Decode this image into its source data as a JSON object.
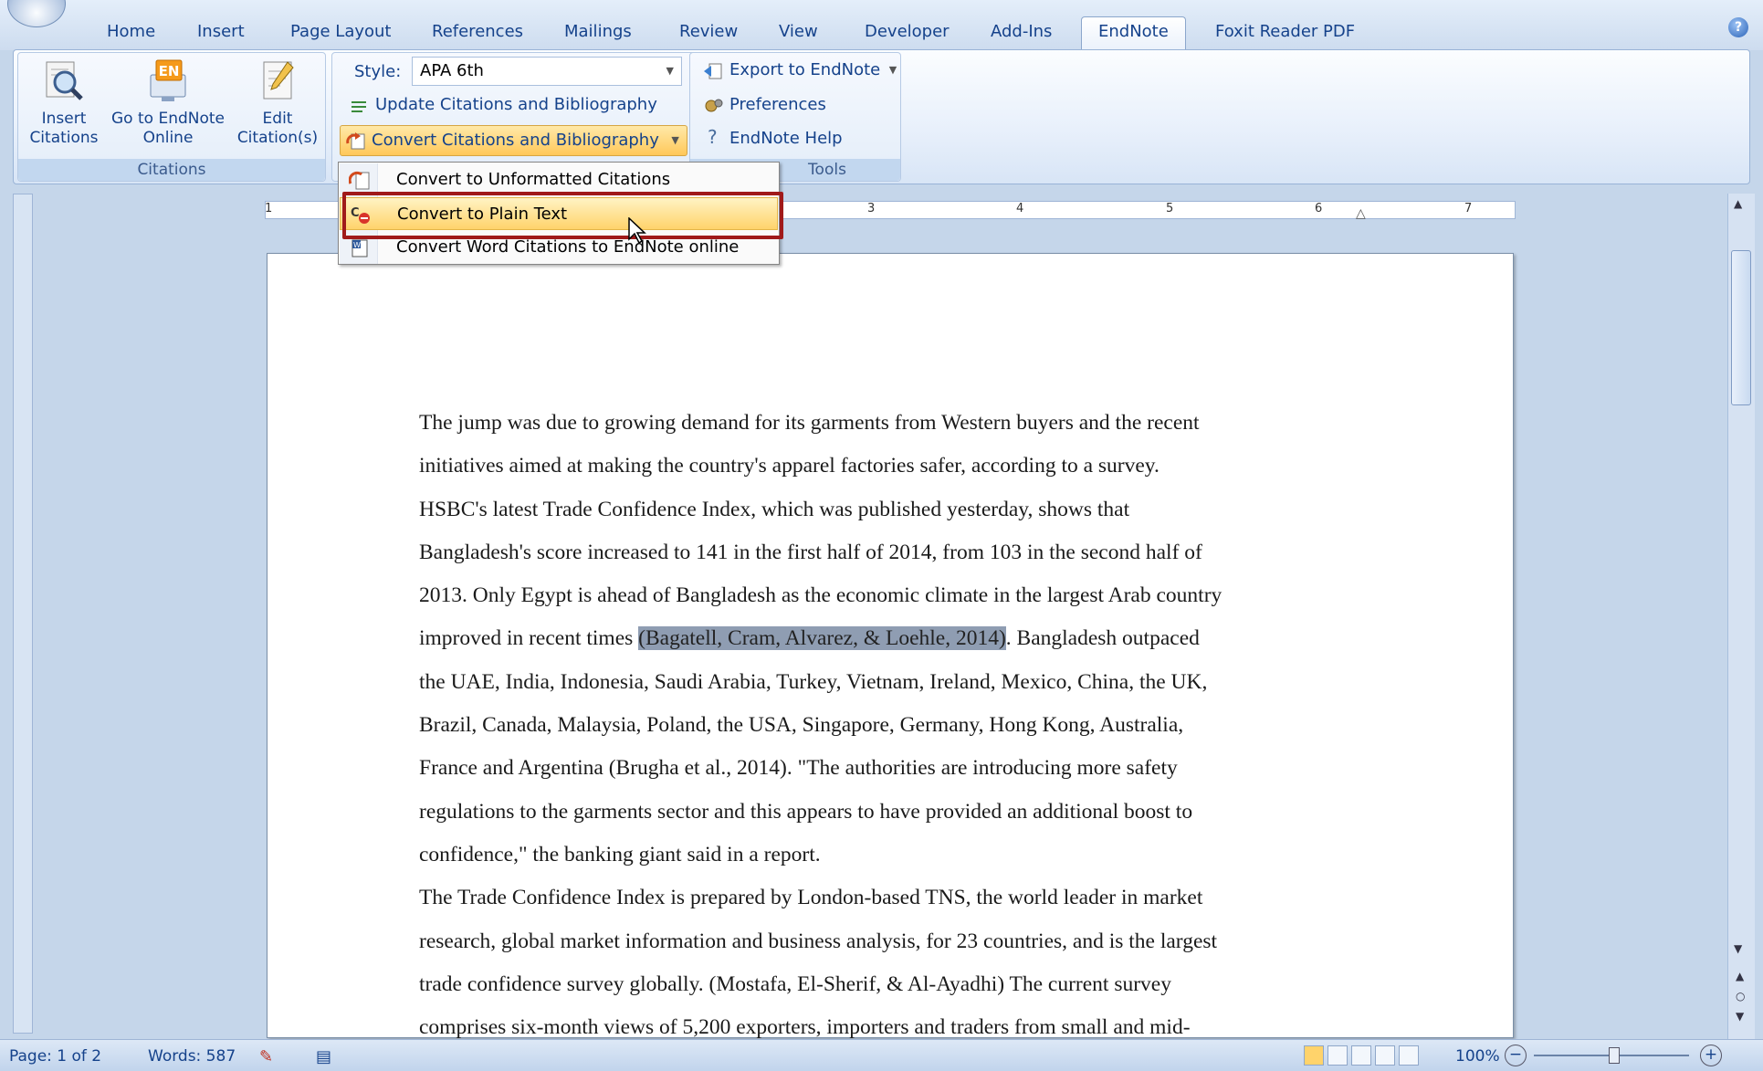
{
  "ribbon_tabs": [
    "Home",
    "Insert",
    "Page Layout",
    "References",
    "Mailings",
    "Review",
    "View",
    "Developer",
    "Add-Ins",
    "EndNote",
    "Foxit Reader PDF"
  ],
  "active_tab": "EndNote",
  "citations_group": {
    "insert_label": "Insert Citations",
    "insert_line1": "Insert",
    "insert_line2": "Citations",
    "goto_line1": "Go to EndNote",
    "goto_line2": "Online",
    "goto_icon_text": "EN",
    "edit_line1": "Edit",
    "edit_line2": "Citation(s)",
    "label": "Citations"
  },
  "bibliography_group": {
    "style_label": "Style:",
    "style_value": "APA 6th",
    "update_label": "Update Citations and Bibliography",
    "convert_label": "Convert Citations and Bibliography"
  },
  "tools_group": {
    "export_label": "Export to EndNote",
    "preferences_label": "Preferences",
    "help_label": "EndNote Help",
    "label_partial": "Tools"
  },
  "convert_menu": {
    "items": [
      {
        "label": "Convert to Unformatted Citations",
        "selected": false
      },
      {
        "label": "Convert to Plain Text",
        "selected": true
      },
      {
        "label": "Convert Word Citations to EndNote online",
        "selected": false
      }
    ]
  },
  "ruler": {
    "numbers": [
      "1",
      "3",
      "4",
      "5",
      "6",
      "7"
    ]
  },
  "document": {
    "lines": [
      {
        "text": "The jump was due to growing demand for its garments from Western buyers and the recent"
      },
      {
        "text": "initiatives aimed at making the country's apparel factories safer, according to a survey."
      },
      {
        "text": "HSBC's latest Trade Confidence Index, which was published yesterday, shows that"
      },
      {
        "text": "Bangladesh's score increased to 141 in the first half of 2014, from 103 in the second half of"
      },
      {
        "text": "2013. Only Egypt is ahead of Bangladesh as the economic climate in the largest Arab country"
      },
      {
        "pre": "improved in recent times ",
        "highlight": "(Bagatell, Cram, Alvarez, & Loehle, 2014)",
        "post": ". Bangladesh outpaced"
      },
      {
        "text": "the UAE, India, Indonesia, Saudi Arabia, Turkey, Vietnam, Ireland, Mexico, China, the UK,"
      },
      {
        "text": "Brazil, Canada, Malaysia, Poland, the USA, Singapore, Germany, Hong Kong, Australia,"
      },
      {
        "text": "France and Argentina (Brugha et al., 2014). \"The authorities are introducing more safety"
      },
      {
        "text": "regulations to the garments sector and this appears to have provided an additional boost to"
      },
      {
        "text": "confidence,\" the banking giant said in a report."
      },
      {
        "text": "The Trade Confidence Index is prepared by London-based TNS, the world leader in market"
      },
      {
        "text": "research, global market information and business analysis, for 23 countries, and is the largest"
      },
      {
        "text": "trade confidence survey globally. (Mostafa, El-Sherif, & Al-Ayadhi) The current survey"
      },
      {
        "text": "comprises six-month views of 5,200 exporters, importers and traders from small and mid-"
      }
    ]
  },
  "status_bar": {
    "page": "Page: 1 of 2",
    "words": "Words: 587",
    "zoom": "100%"
  },
  "colors": {
    "ribbon_text": "#15428b",
    "highlight_box": "#a01a1a",
    "menu_selected": "#ffd36b",
    "citation_highlight": "#8f9db2"
  }
}
